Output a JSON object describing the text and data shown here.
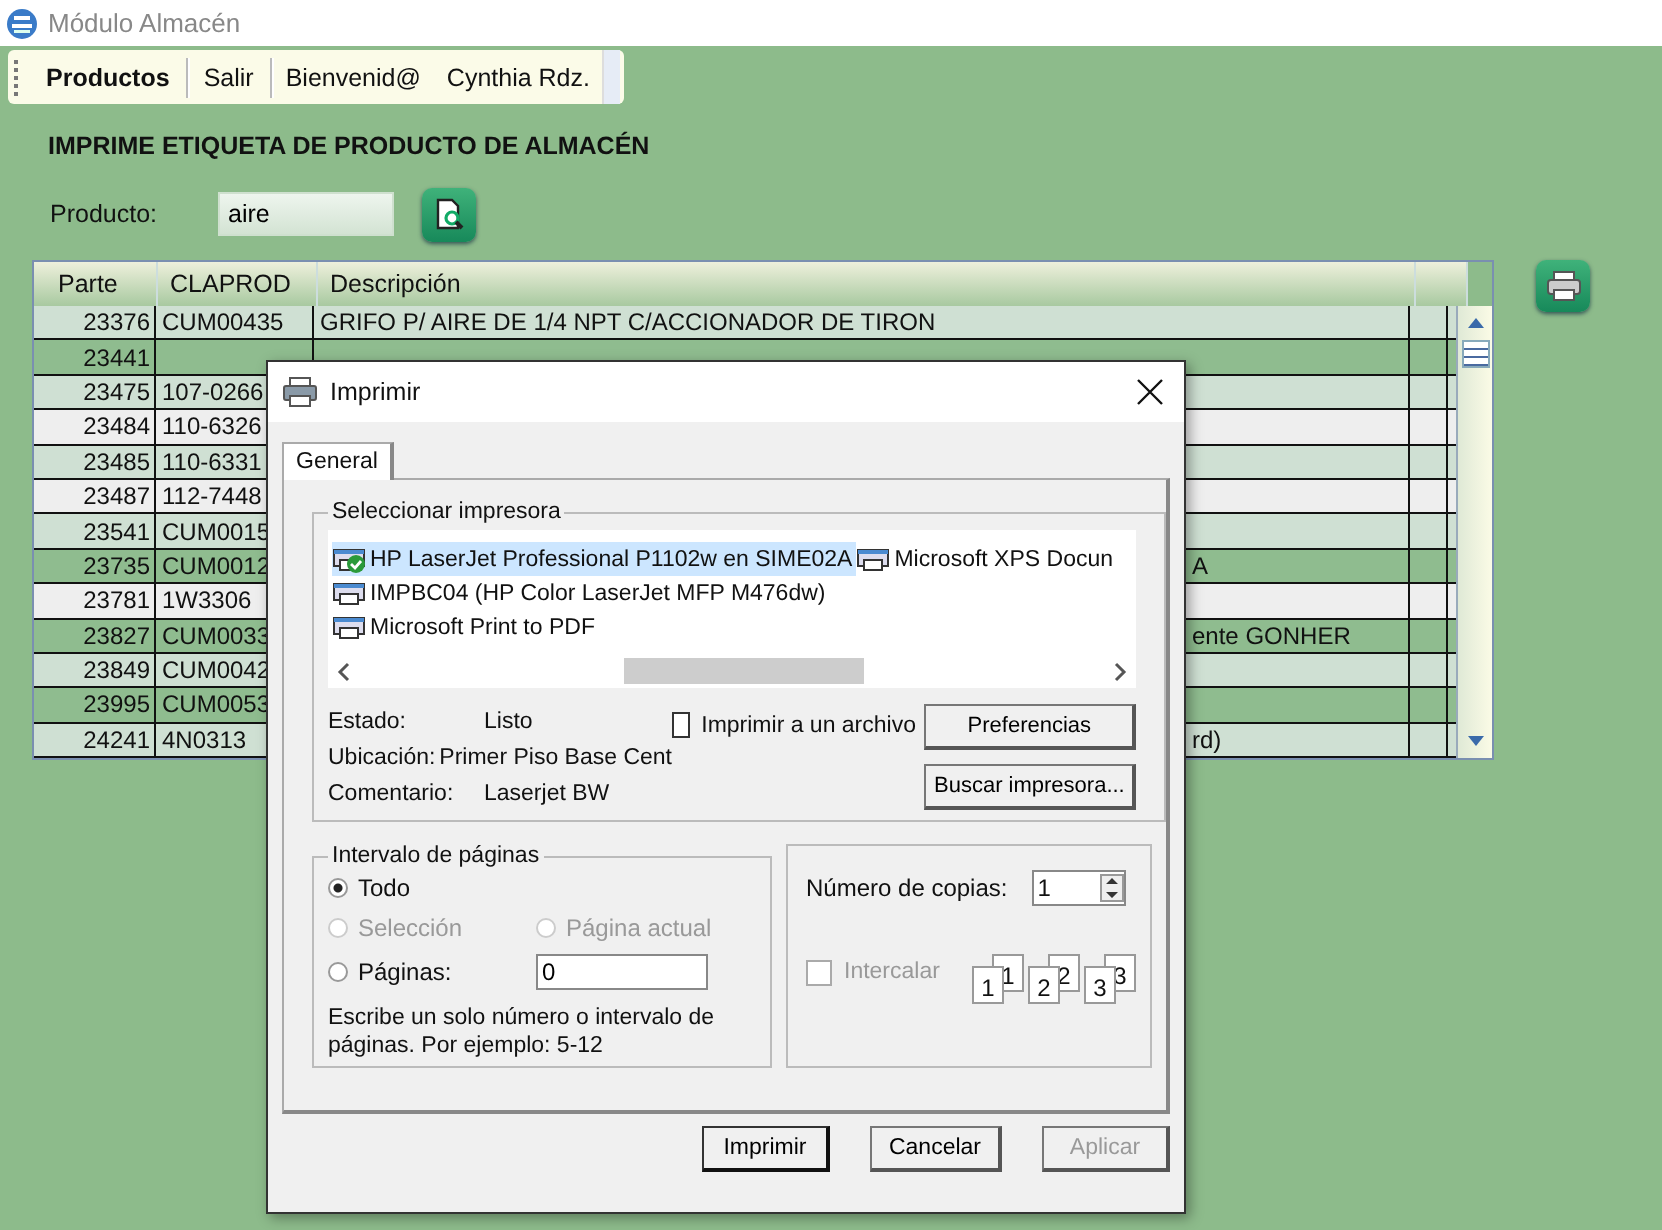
{
  "window": {
    "title": "Módulo Almacén"
  },
  "toolbar": [
    {
      "kind": "button",
      "label": "Productos"
    },
    {
      "kind": "button",
      "label": "Salir"
    },
    {
      "kind": "label",
      "label": "Bienvenid@"
    },
    {
      "kind": "label",
      "label": "Cynthia Rdz."
    }
  ],
  "heading": "IMPRIME ETIQUETA DE PRODUCTO DE ALMACÉN",
  "product": {
    "label": "Producto:",
    "value": "aire"
  },
  "table": {
    "columns": [
      "Parte",
      "CLAPROD",
      "Descripción"
    ],
    "rows": [
      {
        "parte": "23376",
        "claprod": "CUM00435",
        "descripcion": "GRIFO P/ AIRE DE 1/4  NPT  C/ACCIONADOR DE TIRON",
        "color": "#cfe0d3"
      },
      {
        "parte": "23441",
        "color": "#8fbc8f"
      },
      {
        "parte": "23475",
        "claprod": "107-0266",
        "color": "#cfe0d3"
      },
      {
        "parte": "23484",
        "claprod": "110-6326",
        "color": "#eeeeee"
      },
      {
        "parte": "23485",
        "claprod": "110-6331",
        "color": "#cfe0d3"
      },
      {
        "parte": "23487",
        "claprod": "112-7448",
        "color": "#eeeeee"
      },
      {
        "parte": "23541",
        "claprod": "CUM0015",
        "color": "#cfe0d3"
      },
      {
        "parte": "23735",
        "claprod": "CUM0012",
        "descripcion": "A",
        "color": "#8fbc8f"
      },
      {
        "parte": "23781",
        "claprod": "1W3306",
        "color": "#eeeeee"
      },
      {
        "parte": "23827",
        "claprod": "CUM0033",
        "descripcion": "ente GONHER",
        "color": "#8fbc8f"
      },
      {
        "parte": "23849",
        "claprod": "CUM0042",
        "color": "#cfe0d3"
      },
      {
        "parte": "23995",
        "claprod": "CUM0053",
        "color": "#8fbc8f"
      },
      {
        "parte": "24241",
        "claprod": "4N0313",
        "descripcion": "rd)",
        "color": "#cfe0d3"
      }
    ]
  },
  "dialog": {
    "title": "Imprimir",
    "tabs": [
      {
        "label": "General",
        "selected": true
      }
    ],
    "printer_group": "Seleccionar impresora",
    "printers": [
      {
        "name": "HP LaserJet Professional P1102w en SIME02A",
        "selected": true,
        "default": true
      },
      {
        "name": "IMPBC04 (HP Color LaserJet MFP M476dw)",
        "selected": false,
        "default": false
      },
      {
        "name": "Microsoft Print to PDF",
        "selected": false,
        "default": false
      },
      {
        "name": "Microsoft XPS Docun",
        "selected": false,
        "default": false
      }
    ],
    "info": [
      {
        "label": "Estado:",
        "value": "Listo"
      },
      {
        "label": "Ubicación:",
        "value": "Primer Piso Base Cent"
      },
      {
        "label": "Comentario:",
        "value": "Laserjet  BW"
      }
    ],
    "print_to_file": {
      "label": "Imprimir a un archivo",
      "checked": false
    },
    "side_buttons": [
      "Preferencias",
      "Buscar impresora..."
    ],
    "range_group": "Intervalo de páginas",
    "range_options": [
      {
        "label": "Todo",
        "selected": true,
        "disabled": false
      },
      {
        "label": "Selección",
        "selected": false,
        "disabled": true
      },
      {
        "label": "Página actual",
        "selected": false,
        "disabled": true
      },
      {
        "label": "Páginas:",
        "selected": false,
        "disabled": false
      }
    ],
    "pages_value": "0",
    "range_hint": "Escribe un solo número o intervalo de páginas. Por ejemplo: 5-12",
    "copies": {
      "label": "Número de copias:",
      "value": "1"
    },
    "collate": {
      "label": "Intercalar",
      "checked": false,
      "disabled": true
    },
    "collate_pages": [
      {
        "back": "1",
        "front": "1"
      },
      {
        "back": "2",
        "front": "2"
      },
      {
        "back": "3",
        "front": "3"
      }
    ],
    "buttons": [
      {
        "label": "Imprimir",
        "disabled": false
      },
      {
        "label": "Cancelar",
        "disabled": false
      },
      {
        "label": "Aplicar",
        "disabled": true
      }
    ]
  }
}
